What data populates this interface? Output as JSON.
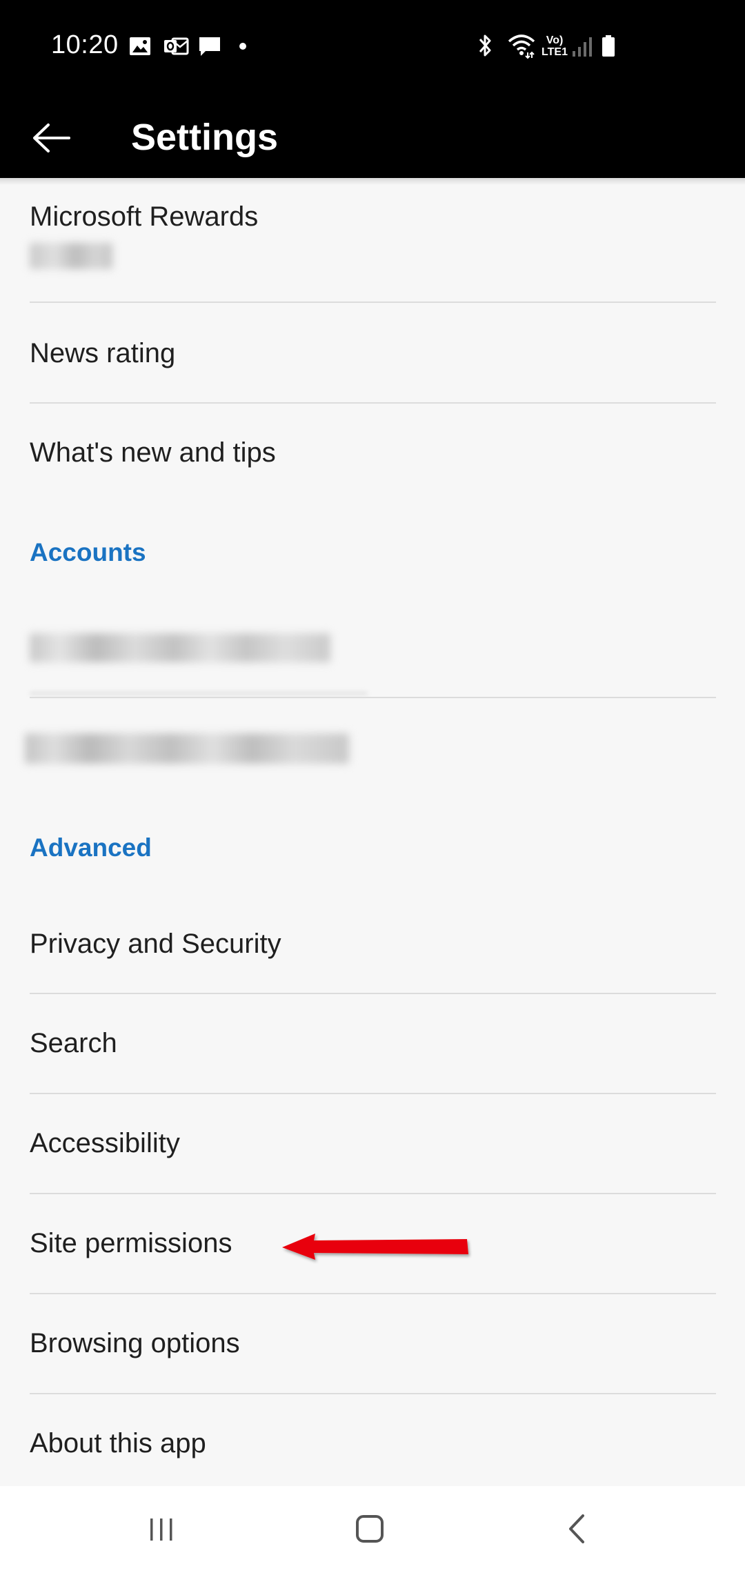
{
  "status_bar": {
    "time": "10:20",
    "notification_icons": [
      "gallery-icon",
      "outlook-icon",
      "message-icon",
      "dot-icon"
    ],
    "system_icons": [
      "bluetooth-icon",
      "wifi-icon",
      "volte-icon",
      "signal-icon",
      "battery-icon"
    ],
    "volte_label": "Vo)",
    "lte_label": "LTE1"
  },
  "app_bar": {
    "title": "Settings",
    "back_icon": "arrow-left-icon"
  },
  "items": {
    "microsoft_rewards": "Microsoft Rewards",
    "news_rating": "News rating",
    "whats_new": "What's new and tips",
    "privacy": "Privacy and Security",
    "search": "Search",
    "accessibility": "Accessibility",
    "site_permissions": "Site permissions",
    "browsing_options": "Browsing options",
    "about": "About this app"
  },
  "sections": {
    "accounts": "Accounts",
    "advanced": "Advanced"
  },
  "colors": {
    "section_header": "#1a73c2",
    "annotation_arrow": "#e8000b",
    "bars": "#000000",
    "background": "#f7f7f7"
  },
  "nav_bar": {
    "icons": [
      "recents-icon",
      "home-icon",
      "back-icon"
    ]
  }
}
